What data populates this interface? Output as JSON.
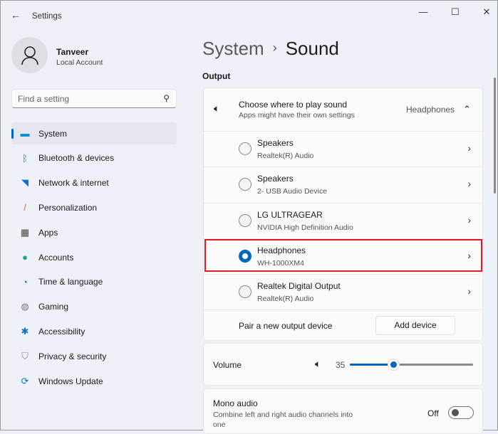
{
  "window": {
    "title": "Settings",
    "back_icon": "arrow-left",
    "minimize": "—",
    "maximize": "☐",
    "close": "✕"
  },
  "profile": {
    "name": "Tanveer",
    "type": "Local Account"
  },
  "search": {
    "placeholder": "Find a setting"
  },
  "nav": [
    {
      "label": "System",
      "icon": "▬",
      "color": "#0f8bd0",
      "selected": true
    },
    {
      "label": "Bluetooth & devices",
      "icon": "ᛒ",
      "color": "#0a74d6"
    },
    {
      "label": "Network & internet",
      "icon": "◥",
      "color": "#0a74d6"
    },
    {
      "label": "Personalization",
      "icon": "/",
      "color": "#d86a2a"
    },
    {
      "label": "Apps",
      "icon": "▦",
      "color": "#444"
    },
    {
      "label": "Accounts",
      "icon": "●",
      "color": "#1aa68a"
    },
    {
      "label": "Time & language",
      "icon": "◔",
      "color": "#0a74d6"
    },
    {
      "label": "Gaming",
      "icon": "◍",
      "color": "#777"
    },
    {
      "label": "Accessibility",
      "icon": "✱",
      "color": "#0a74d6"
    },
    {
      "label": "Privacy & security",
      "icon": "⛉",
      "color": "#888"
    },
    {
      "label": "Windows Update",
      "icon": "⟳",
      "color": "#0a74d6"
    }
  ],
  "breadcrumb": {
    "parent": "System",
    "sep": "›",
    "current": "Sound"
  },
  "output": {
    "section": "Output",
    "header": {
      "title": "Choose where to play sound",
      "subtitle": "Apps might have their own settings",
      "value": "Headphones",
      "chevron": "⌃"
    },
    "devices": [
      {
        "name": "Speakers",
        "desc": "Realtek(R) Audio",
        "selected": false
      },
      {
        "name": "Speakers",
        "desc": "2- USB Audio Device",
        "selected": false
      },
      {
        "name": "LG ULTRAGEAR",
        "desc": "NVIDIA High Definition Audio",
        "selected": false
      },
      {
        "name": "Headphones",
        "desc": "WH-1000XM4",
        "selected": true
      },
      {
        "name": "Realtek Digital Output",
        "desc": "Realtek(R) Audio",
        "selected": false
      }
    ],
    "pair": {
      "label": "Pair a new output device",
      "button": "Add device"
    }
  },
  "volume": {
    "label": "Volume",
    "value": "35",
    "percent": 35
  },
  "mono": {
    "title": "Mono audio",
    "desc": "Combine left and right audio channels into one",
    "state": "Off"
  },
  "colors": {
    "accent": "#0067c0",
    "highlight": "#e01b24"
  }
}
